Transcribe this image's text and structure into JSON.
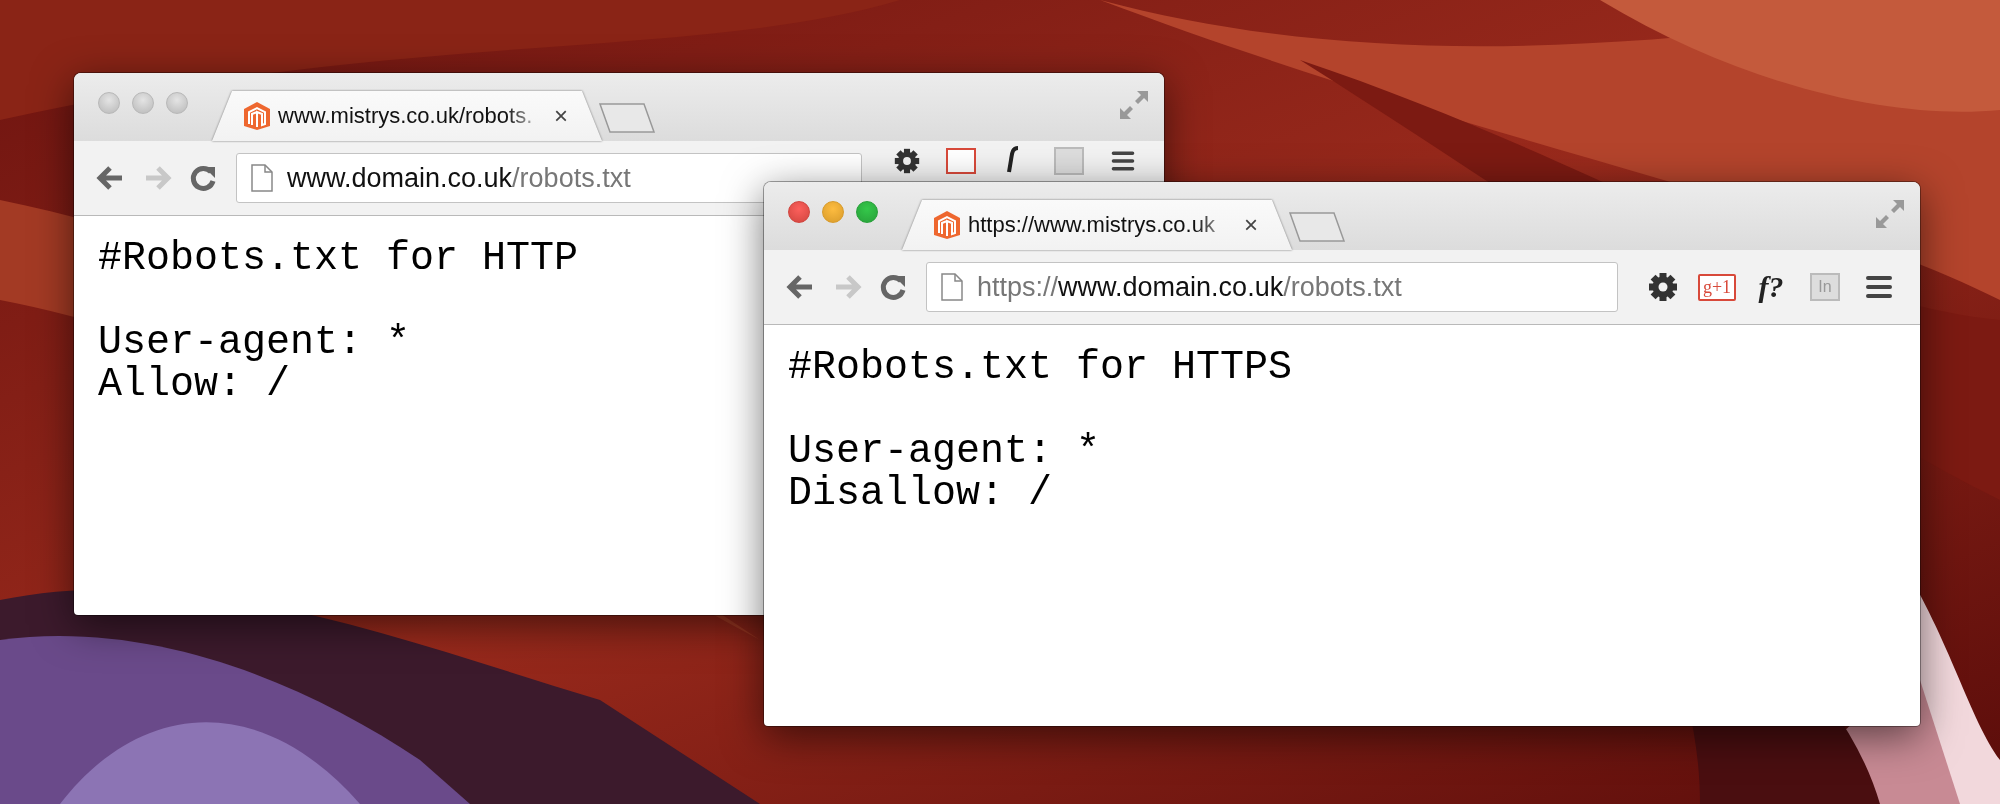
{
  "windows": [
    {
      "active": false,
      "tab": {
        "title": "www.mistrys.co.uk/robots.",
        "close": "×"
      },
      "can_go_forward": false,
      "url": {
        "host": "www.domain.co.uk",
        "path": "/robots.txt"
      },
      "extensions": [
        {
          "kind": "gplus"
        },
        {
          "kind": "fquery"
        },
        {
          "kind": "dim-badge"
        }
      ],
      "content": [
        [
          "#Robots.txt for HTTP"
        ],
        [
          "User-agent: *",
          "Allow: /"
        ]
      ]
    },
    {
      "active": true,
      "tab": {
        "title": "https://www.mistrys.co.uk",
        "close": "×"
      },
      "can_go_forward": false,
      "url": {
        "scheme": "https://",
        "host": "www.domain.co.uk",
        "path": "/robots.txt"
      },
      "extensions": [
        {
          "kind": "gplus",
          "label": "g+1"
        },
        {
          "kind": "fquery",
          "label": "f?"
        },
        {
          "kind": "dim-badge",
          "label": "In"
        }
      ],
      "content": [
        [
          "#Robots.txt for HTTPS"
        ],
        [
          "User-agent: *",
          "Disallow: /"
        ]
      ]
    }
  ]
}
